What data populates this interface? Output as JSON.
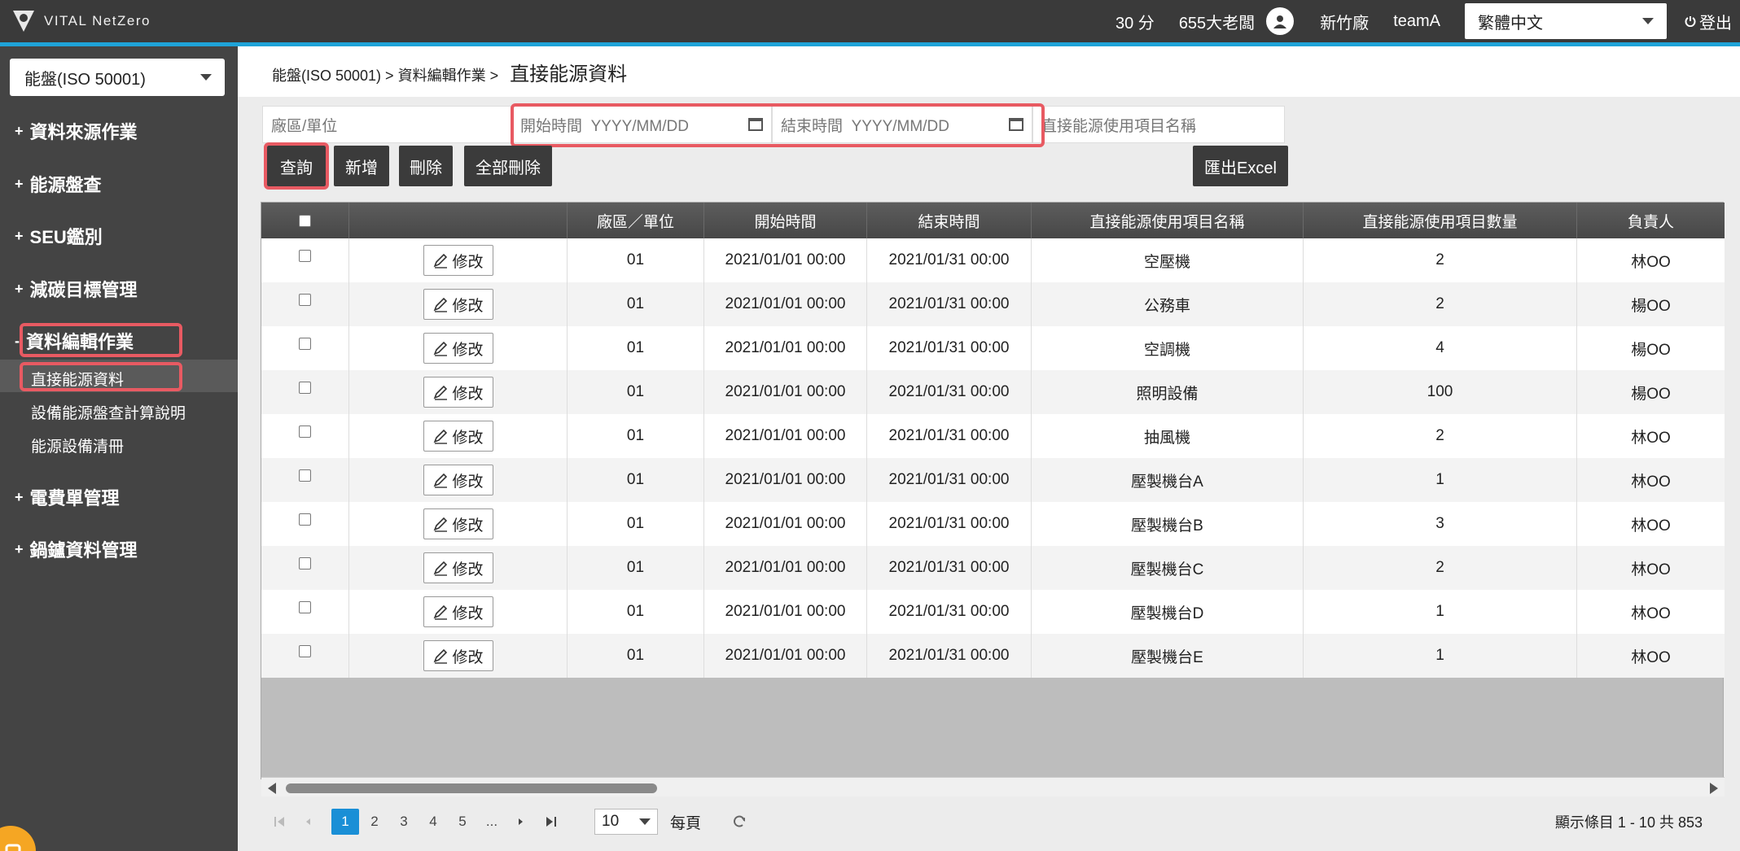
{
  "app": {
    "logo_text": "VITAL NetZero"
  },
  "topbar": {
    "score": "30 分",
    "user": "655大老闆",
    "site": "新竹廠",
    "team": "teamA",
    "language": "繁體中文",
    "logout": "登出"
  },
  "sidebar": {
    "module": "能盤(ISO 50001)",
    "groups": {
      "g1": "資料來源作業",
      "g2": "能源盤查",
      "g3": "SEU鑑別",
      "g4": "減碳目標管理",
      "g5": "資料編輯作業",
      "g6": "電費單管理",
      "g7": "鍋鑪資料管理"
    },
    "subs": {
      "s1": "直接能源資料",
      "s2": "設備能源盤查計算說明",
      "s3": "能源設備清冊"
    }
  },
  "breadcrumb": {
    "path": "能盤(ISO 50001) > 資料編輯作業 >",
    "current": "直接能源資料"
  },
  "filters": {
    "site_unit": "廠區/單位",
    "start_label": "開始時間",
    "start_placeholder": "YYYY/MM/DD",
    "end_label": "結束時間",
    "end_placeholder": "YYYY/MM/DD",
    "item_name": "直接能源使用項目名稱"
  },
  "buttons": {
    "query": "查詢",
    "add": "新增",
    "delete": "刪除",
    "delete_all": "全部刪除",
    "export": "匯出Excel"
  },
  "table": {
    "headers": {
      "site": "廠區／單位",
      "start": "開始時間",
      "end": "結束時間",
      "name": "直接能源使用項目名稱",
      "qty": "直接能源使用項目數量",
      "owner": "負責人"
    },
    "edit_label": "修改",
    "rows": [
      {
        "site": "01",
        "start": "2021/01/01 00:00",
        "end": "2021/01/31 00:00",
        "name": "空壓機",
        "qty": "2",
        "owner": "林OO"
      },
      {
        "site": "01",
        "start": "2021/01/01 00:00",
        "end": "2021/01/31 00:00",
        "name": "公務車",
        "qty": "2",
        "owner": "楊OO"
      },
      {
        "site": "01",
        "start": "2021/01/01 00:00",
        "end": "2021/01/31 00:00",
        "name": "空調機",
        "qty": "4",
        "owner": "楊OO"
      },
      {
        "site": "01",
        "start": "2021/01/01 00:00",
        "end": "2021/01/31 00:00",
        "name": "照明設備",
        "qty": "100",
        "owner": "楊OO"
      },
      {
        "site": "01",
        "start": "2021/01/01 00:00",
        "end": "2021/01/31 00:00",
        "name": "抽風機",
        "qty": "2",
        "owner": "林OO"
      },
      {
        "site": "01",
        "start": "2021/01/01 00:00",
        "end": "2021/01/31 00:00",
        "name": "壓製機台A",
        "qty": "1",
        "owner": "林OO"
      },
      {
        "site": "01",
        "start": "2021/01/01 00:00",
        "end": "2021/01/31 00:00",
        "name": "壓製機台B",
        "qty": "3",
        "owner": "林OO"
      },
      {
        "site": "01",
        "start": "2021/01/01 00:00",
        "end": "2021/01/31 00:00",
        "name": "壓製機台C",
        "qty": "2",
        "owner": "林OO"
      },
      {
        "site": "01",
        "start": "2021/01/01 00:00",
        "end": "2021/01/31 00:00",
        "name": "壓製機台D",
        "qty": "1",
        "owner": "林OO"
      },
      {
        "site": "01",
        "start": "2021/01/01 00:00",
        "end": "2021/01/31 00:00",
        "name": "壓製機台E",
        "qty": "1",
        "owner": "林OO"
      }
    ]
  },
  "pager": {
    "pages": [
      "1",
      "2",
      "3",
      "4",
      "5",
      "..."
    ],
    "page_size": "10",
    "per_page_label": "每頁",
    "summary": "顯示條目 1 - 10 共 853"
  },
  "colors": {
    "accent": "#1fa3d8",
    "highlight": "#e85a62",
    "sidebar": "#444444",
    "pager_active": "#1a8fd6"
  }
}
